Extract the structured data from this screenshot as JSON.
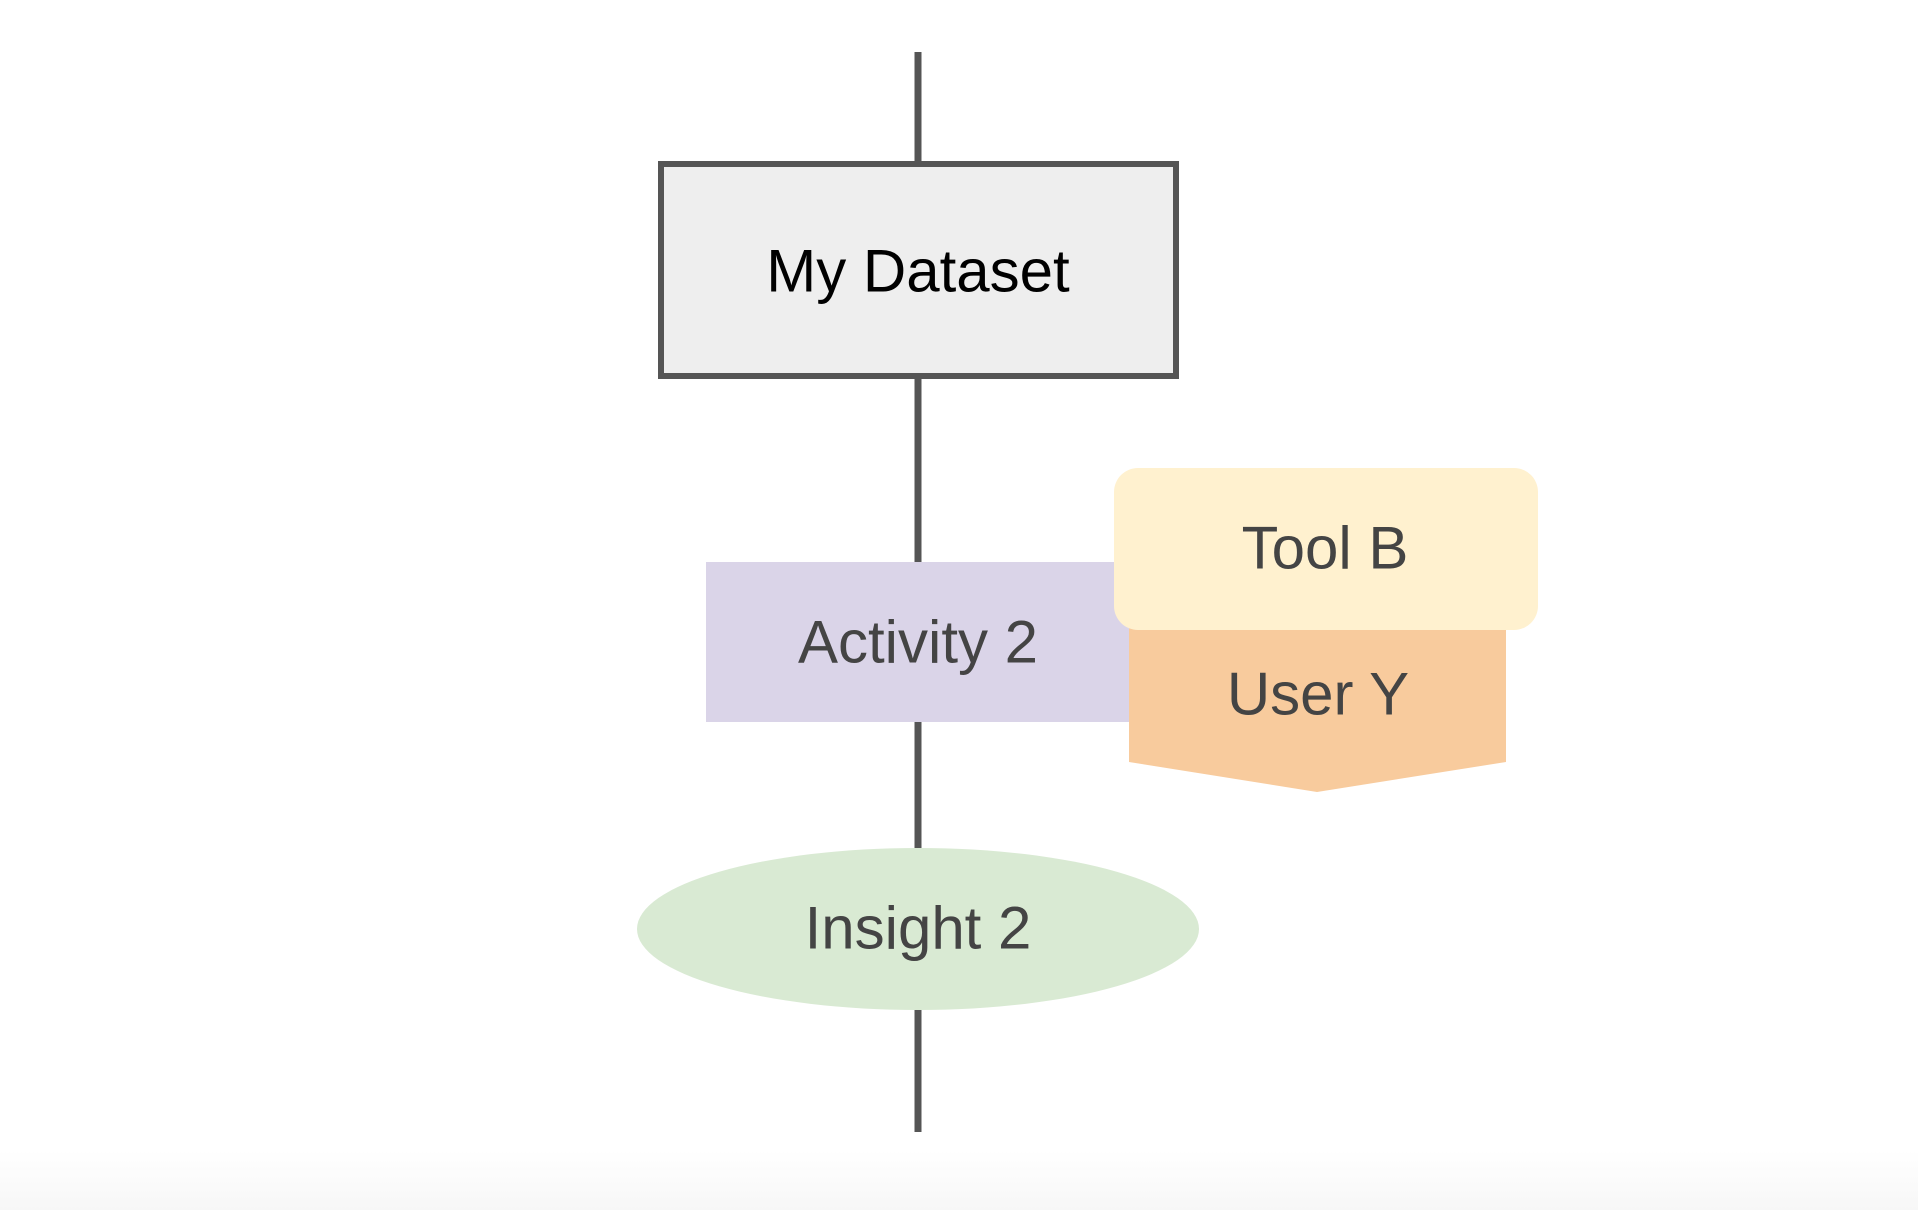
{
  "diagram": {
    "nodes": {
      "dataset": {
        "label": "My Dataset",
        "fill": "#EEEEEE",
        "stroke": "#555555"
      },
      "activity": {
        "label": "Activity 2",
        "fill": "#DAD4E8"
      },
      "tool": {
        "label": "Tool B",
        "fill": "#FFF1CF"
      },
      "user": {
        "label": "User Y",
        "fill": "#F8CB9D"
      },
      "insight": {
        "label": "Insight 2",
        "fill": "#D9EAD3"
      }
    },
    "colors": {
      "connector": "#555555",
      "text_dark": "#000000",
      "text_gray": "#444444"
    }
  }
}
